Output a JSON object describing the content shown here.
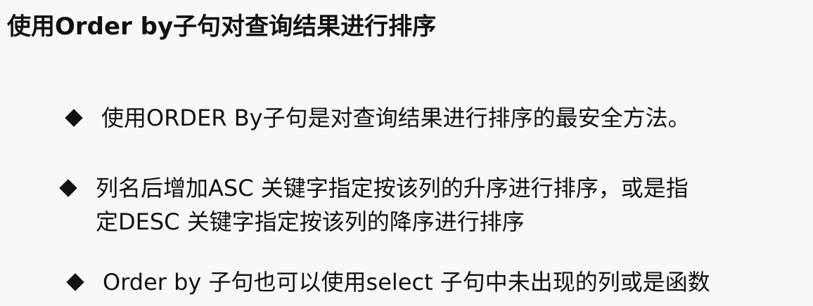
{
  "slide": {
    "title": "使用Order by子句对查询结果进行排序",
    "bullets": [
      {
        "text": "使用ORDER By子句是对查询结果进行排序的最安全方法。"
      },
      {
        "lines": [
          "列名后增加ASC 关键字指定按该列的升序进行排序，或是指",
          "定DESC 关键字指定按该列的降序进行排序"
        ]
      },
      {
        "text": "Order by 子句也可以使用select 子句中未出现的列或是函数"
      }
    ],
    "bullet_icon": "diamond-bullet-icon"
  }
}
